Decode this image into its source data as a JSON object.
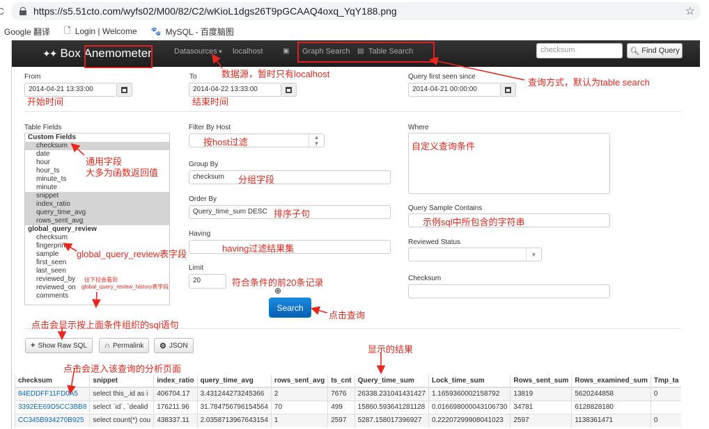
{
  "browser": {
    "url": "https://s5.51cto.com/wyfs02/M00/82/C2/wKioL1dgs26T9pGCAAQ4oxq_YqY188.png",
    "bookmarks": [
      "Google 翻译",
      "Login | Welcome",
      "MySQL - 百度脑图"
    ]
  },
  "nav": {
    "brand_box": "Box",
    "brand_name": "Anemometer",
    "datasources": "Datasources",
    "localhost": "localhost",
    "graph_search": "Graph Search",
    "table_search": "Table Search",
    "search_placeholder": "checksum",
    "find_query": "Find Query"
  },
  "form": {
    "from_label": "From",
    "from_value": "2014-04-21 13:33:00",
    "to_label": "To",
    "to_value": "2014-04-22 13:33:00",
    "first_seen_label": "Query first seen since",
    "first_seen_value": "2014-04-21 00:00:00",
    "table_fields_label": "Table Fields",
    "filter_host_label": "Filter By Host",
    "group_by_label": "Group By",
    "group_by_value": "checksum",
    "order_by_label": "Order By",
    "order_by_value": "Query_time_sum DESC",
    "having_label": "Having",
    "limit_label": "Limit",
    "limit_value": "20",
    "where_label": "Where",
    "sample_contains_label": "Query Sample Contains",
    "reviewed_status_label": "Reviewed Status",
    "checksum_label": "Checksum",
    "search_button": "Search"
  },
  "table_fields": [
    {
      "label": "Custom Fields",
      "group": true,
      "selected": false
    },
    {
      "label": "checksum",
      "group": false,
      "selected": true
    },
    {
      "label": "date",
      "group": false,
      "selected": false
    },
    {
      "label": "hour",
      "group": false,
      "selected": false
    },
    {
      "label": "hour_ts",
      "group": false,
      "selected": false
    },
    {
      "label": "minute_ts",
      "group": false,
      "selected": false
    },
    {
      "label": "minute",
      "group": false,
      "selected": false
    },
    {
      "label": "snippet",
      "group": false,
      "selected": true
    },
    {
      "label": "index_ratio",
      "group": false,
      "selected": true
    },
    {
      "label": "query_time_avg",
      "group": false,
      "selected": true
    },
    {
      "label": "rows_sent_avg",
      "group": false,
      "selected": true
    },
    {
      "label": "global_query_review",
      "group": true,
      "selected": false
    },
    {
      "label": "checksum",
      "group": false,
      "selected": false
    },
    {
      "label": "fingerprint",
      "group": false,
      "selected": false
    },
    {
      "label": "sample",
      "group": false,
      "selected": false
    },
    {
      "label": "first_seen",
      "group": false,
      "selected": false
    },
    {
      "label": "last_seen",
      "group": false,
      "selected": false
    },
    {
      "label": "reviewed_by",
      "group": false,
      "selected": false
    },
    {
      "label": "reviewed_on",
      "group": false,
      "selected": false
    },
    {
      "label": "comments",
      "group": false,
      "selected": false
    }
  ],
  "actions": {
    "show_raw_sql": "Show Raw SQL",
    "permalink": "Permalink",
    "json": "JSON"
  },
  "results": {
    "columns": [
      "checksum",
      "snippet",
      "index_ratio",
      "query_time_avg",
      "rows_sent_avg",
      "ts_cnt",
      "Query_time_sum",
      "Lock_time_sum",
      "Rows_sent_sum",
      "Rows_examined_sum",
      "Tmp_ta"
    ],
    "rows": [
      [
        "84EDDFF11FD0A5",
        "select this_.id as i",
        "406704.17",
        "3.431244273245366",
        "2",
        "7676",
        "26338.231041431427",
        "1.1659360002158792",
        "13819",
        "5620244858",
        "0"
      ],
      [
        "3392EE69D5CC3BB8",
        "select `id`, `dealid",
        "176211.96",
        "31.784756796154564",
        "70",
        "499",
        "15860.593641281128",
        "0.016698000043106730",
        "34781",
        "6128828180",
        ""
      ],
      [
        "CC345B934270B925",
        "select count(*) cou",
        "438337.11",
        "2.0358713967643154",
        "1",
        "2597",
        "5287.158017396927",
        "0.22207299908041023",
        "2597",
        "1138361471",
        "0"
      ]
    ]
  },
  "annotations": {
    "datasource": "数据源，暂时只有localhost",
    "search_mode": "查询方式，默认为table search",
    "start_time": "开始时间",
    "end_time": "结束时间",
    "common_fields_1": "通用字段",
    "common_fields_2": "大多为函数返回值",
    "by_host": "按host过滤",
    "group_field": "分组字段",
    "custom_where": "自定义查询条件",
    "order_clause": "排序子句",
    "sample_contains": "示例sql中所包含的字符串",
    "review_fields": "global_query_review表字段",
    "having_filter": "having过滤结果集",
    "top20": "符合条件的前20条记录",
    "scroll_hint_1": "往下拉会看到",
    "scroll_hint_2": "global_query_review_history表字段",
    "click_query": "点击查询",
    "raw_sql_hint": "点击会显示按上面条件组织的sql语句",
    "results_hint": "显示的结果",
    "analysis_hint": "点击会进入该查询的分析页面"
  }
}
